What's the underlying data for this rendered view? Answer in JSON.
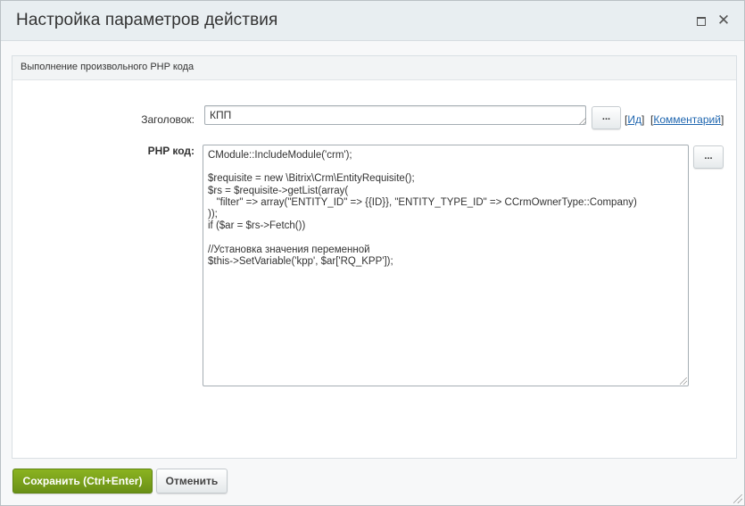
{
  "dialog": {
    "title": "Настройка параметров действия",
    "maximize_icon": "maximize-icon",
    "close_icon": "close-icon",
    "close_glyph": "✕"
  },
  "section": {
    "title": "Выполнение произвольного PHP кода"
  },
  "form": {
    "title_label": "Заголовок:",
    "title_value": "КПП",
    "dots_label": "...",
    "link_open": "[",
    "link_close": "]",
    "id_link": "Ид",
    "comment_link": "Комментарий",
    "php_label": "PHP код:",
    "php_code": "CModule::IncludeModule('crm');\n\n$requisite = new \\Bitrix\\Crm\\EntityRequisite();\n$rs = $requisite->getList(array(\n   \"filter\" => array(\"ENTITY_ID\" => {{ID}}, \"ENTITY_TYPE_ID\" => CCrmOwnerType::Company)\n));\nif ($ar = $rs->Fetch())\n\n//Установка значения переменной\n$this->SetVariable('kpp', $ar['RQ_KPP']);"
  },
  "footer": {
    "save_label": "Сохранить (Ctrl+Enter)",
    "cancel_label": "Отменить"
  },
  "colors": {
    "accent_green": "#7aa21c",
    "link_blue": "#2067b0",
    "titlebar_bg": "#e8eef1"
  }
}
